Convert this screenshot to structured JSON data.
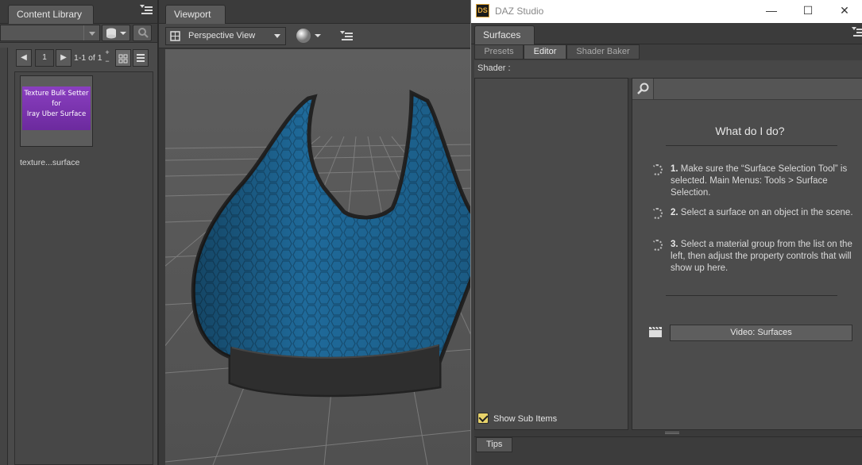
{
  "content_library": {
    "tab_label": "Content Library",
    "page_number": "1",
    "page_range": "1-1 of 1",
    "item_thumbnail_text": [
      "Texture Bulk Setter",
      "for",
      "Iray Uber Surface"
    ],
    "item_label": "texture...surface"
  },
  "viewport": {
    "tab_label": "Viewport",
    "camera_label": "Perspective View"
  },
  "window": {
    "logo": "DS",
    "title": "DAZ Studio",
    "minimize": "—",
    "maximize": "☐",
    "close": "✕"
  },
  "surfaces": {
    "tab_label": "Surfaces",
    "subtabs": [
      "Presets",
      "Editor",
      "Shader Baker"
    ],
    "active_subtab": "Editor",
    "shader_label": "Shader :",
    "help_title": "What do I do?",
    "steps": [
      {
        "num": "1.",
        "text": "Make sure the “Surface Selection Tool” is selected. Main Menus: Tools > Surface Selection."
      },
      {
        "num": "2.",
        "text": "Select a surface on an object in the scene."
      },
      {
        "num": "3.",
        "text": "Select a material group from the list on the left, then adjust the property controls that will show up here."
      }
    ],
    "video_button": "Video: Surfaces",
    "show_sub_items_label": "Show Sub Items",
    "show_sub_items_checked": true,
    "tips_tab": "Tips"
  },
  "colors": {
    "accent_checkbox": "#e8d36a",
    "garment_blue": "#1f6a9a",
    "thumbnail_purple": "#7b35b0"
  }
}
